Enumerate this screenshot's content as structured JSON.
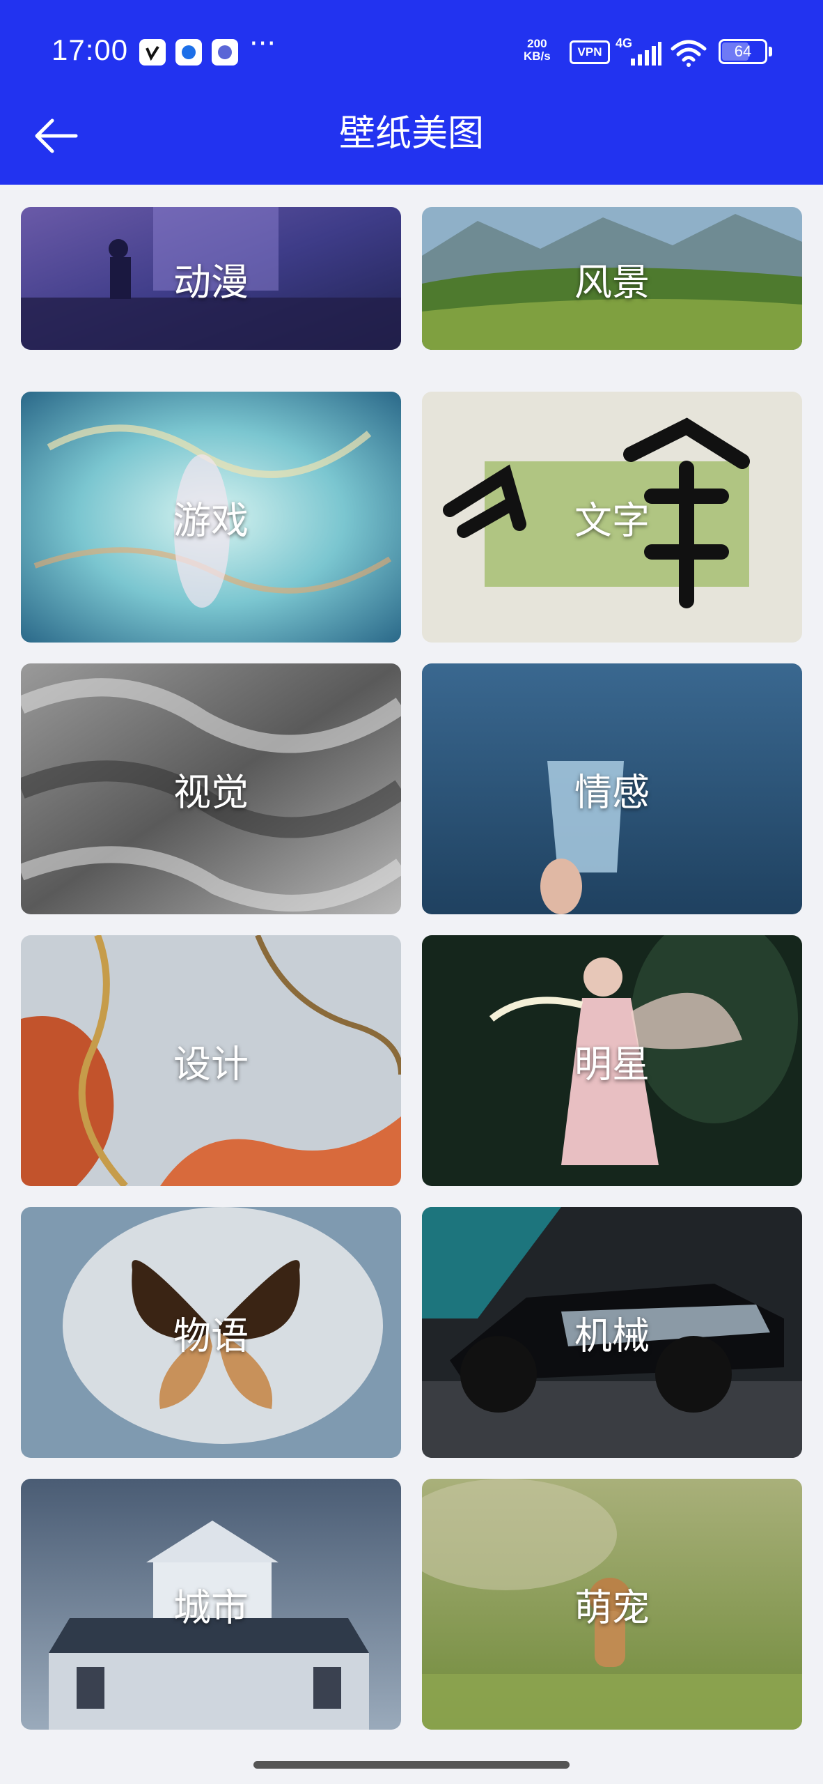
{
  "status_bar": {
    "time": "17:00",
    "more": "···",
    "speed_value": "200",
    "speed_unit": "KB/s",
    "vpn": "VPN",
    "network": "4G",
    "battery": "64",
    "battery_level": 0.64,
    "icons": [
      "app-notification-icon",
      "app-notification-icon",
      "app-notification-icon",
      "signal-icon",
      "wifi-icon",
      "battery-icon"
    ]
  },
  "nav": {
    "title": "壁纸美图",
    "back_icon": "back-arrow-icon"
  },
  "categories": [
    {
      "label": "动漫"
    },
    {
      "label": "风景"
    },
    {
      "label": "游戏"
    },
    {
      "label": "文字"
    },
    {
      "label": "视觉"
    },
    {
      "label": "情感"
    },
    {
      "label": "设计"
    },
    {
      "label": "明星"
    },
    {
      "label": "物语"
    },
    {
      "label": "机械"
    },
    {
      "label": "城市"
    },
    {
      "label": "萌宠"
    }
  ],
  "colors": {
    "header": "#2233f0",
    "background": "#f1f2f6",
    "label": "#ffffff"
  }
}
